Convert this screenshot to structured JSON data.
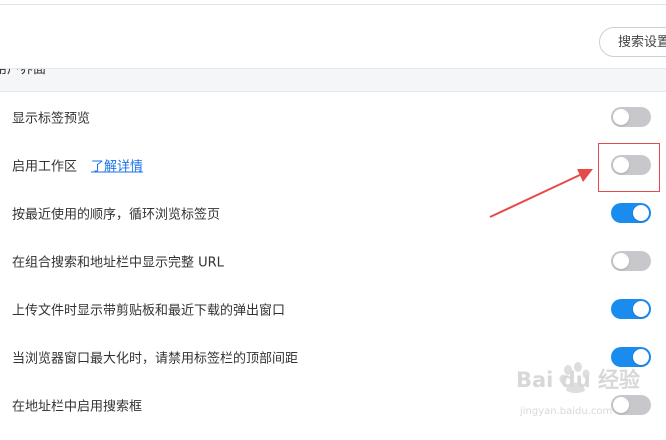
{
  "search": {
    "placeholder": "搜索设置"
  },
  "section": {
    "title": "用户界面"
  },
  "settings": [
    {
      "label": "显示标签预览",
      "enabled": false
    },
    {
      "label": "启用工作区",
      "link": "了解详情",
      "enabled": false
    },
    {
      "label": "按最近使用的顺序，循环浏览标签页",
      "enabled": true
    },
    {
      "label": "在组合搜索和地址栏中显示完整 URL",
      "enabled": false
    },
    {
      "label": "上传文件时显示带剪贴板和最近下载的弹出窗口",
      "enabled": true
    },
    {
      "label": "当浏览器窗口最大化时，请禁用标签栏的顶部间距",
      "enabled": true
    },
    {
      "label": "在地址栏中启用搜索框",
      "enabled": false
    }
  ],
  "colors": {
    "toggle_on": "#1a8cf0",
    "toggle_off": "#c8c8cc",
    "annotation": "#e84a4a",
    "link": "#1a73e8"
  },
  "watermark": {
    "brand": "Bai du 经验",
    "url": "jingyan.baidu.com"
  }
}
